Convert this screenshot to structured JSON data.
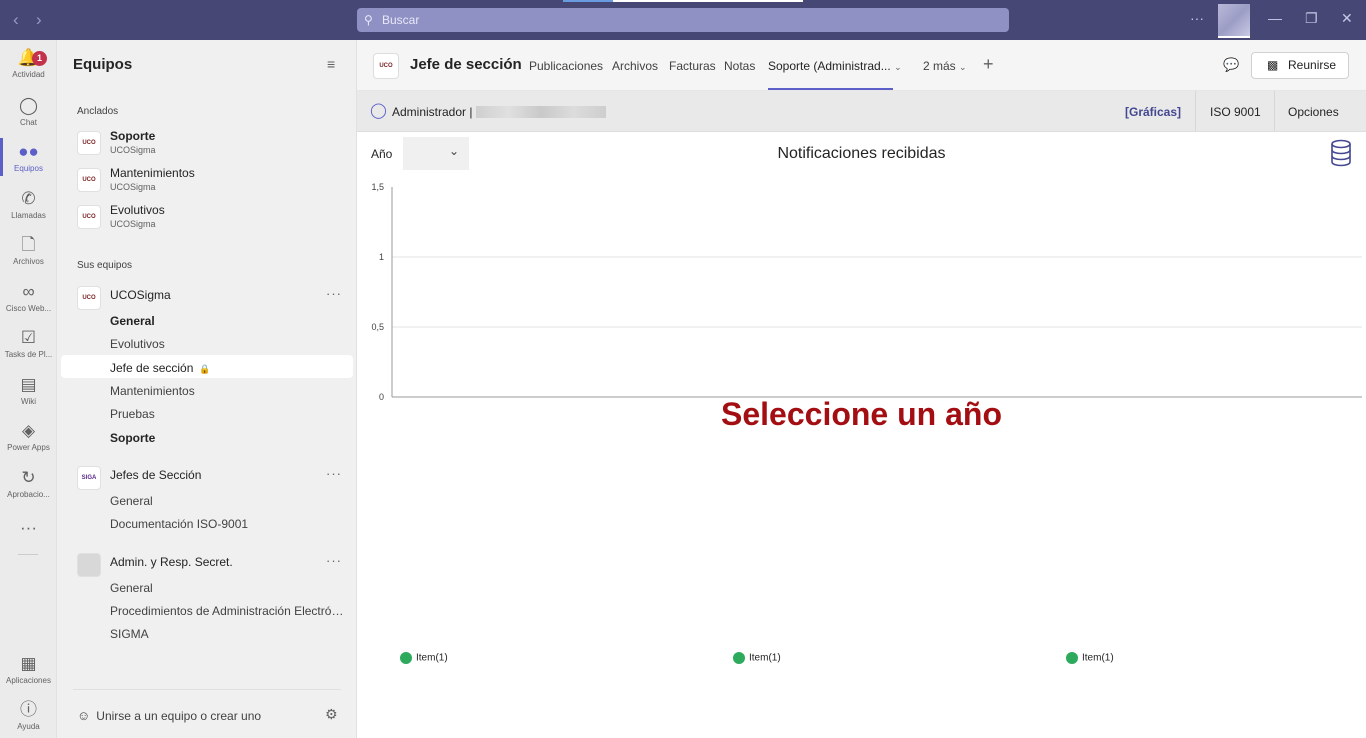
{
  "titlebar": {
    "search_placeholder": "Buscar",
    "more": "···"
  },
  "rail": {
    "items": [
      {
        "label": "Actividad",
        "icon": "bell-icon",
        "badge": "1"
      },
      {
        "label": "Chat",
        "icon": "chat-icon"
      },
      {
        "label": "Equipos",
        "icon": "teams-icon"
      },
      {
        "label": "Llamadas",
        "icon": "phone-icon"
      },
      {
        "label": "Archivos",
        "icon": "file-icon"
      },
      {
        "label": "Cisco Web...",
        "icon": "webex-icon"
      },
      {
        "label": "Tasks de Pl...",
        "icon": "tasks-icon"
      },
      {
        "label": "Wiki",
        "icon": "wiki-icon"
      },
      {
        "label": "Power Apps",
        "icon": "powerapps-icon"
      },
      {
        "label": "Aprobacio...",
        "icon": "approvals-icon"
      },
      {
        "label": "Aplicaciones",
        "icon": "apps-icon"
      },
      {
        "label": "Ayuda",
        "icon": "help-icon"
      }
    ],
    "more": "···"
  },
  "teamlist": {
    "title": "Equipos",
    "pinned_label": "Anclados",
    "pinned": [
      {
        "name": "Soporte",
        "sub": "UCOSigma"
      },
      {
        "name": "Mantenimientos",
        "sub": "UCOSigma"
      },
      {
        "name": "Evolutivos",
        "sub": "UCOSigma"
      }
    ],
    "your_teams_label": "Sus equipos",
    "teams": [
      {
        "name": "UCOSigma",
        "logo": "UCO",
        "channels": [
          "General",
          "Evolutivos",
          "Jefe de sección",
          "Mantenimientos",
          "Pruebas",
          "Soporte"
        ]
      },
      {
        "name": "Jefes de Sección",
        "logo": "SIGA",
        "channels": [
          "General",
          "Documentación ISO-9001"
        ]
      },
      {
        "name": "Admin. y Resp. Secret.",
        "logo": "",
        "channels": [
          "General",
          "Procedimientos de Administración Electróni...",
          "SIGMA"
        ]
      }
    ],
    "join_label": "Unirse a un equipo o crear uno"
  },
  "channel_header": {
    "logo": "UCO",
    "title": "Jefe de sección",
    "tabs": [
      "Publicaciones",
      "Archivos",
      "Facturas",
      "Notas",
      "Soporte (Administrad...",
      "2 más"
    ],
    "meet_label": "Reunirse"
  },
  "subheader": {
    "admin_label": "Administrador |",
    "links": [
      "[Gráficas]",
      "ISO 9001",
      "Opciones"
    ]
  },
  "chart_controls": {
    "year_label": "Año",
    "year_value": ""
  },
  "chart_data": {
    "type": "line",
    "title": "Notificaciones recibidas",
    "xlabel": "",
    "ylabel": "",
    "ylim": [
      0,
      1.5
    ],
    "yticks": [
      "1,5",
      "1",
      "0,5",
      "0"
    ],
    "series": [
      {
        "name": "Item(1)",
        "values": []
      },
      {
        "name": "Item(1)",
        "values": []
      },
      {
        "name": "Item(1)",
        "values": []
      }
    ],
    "legend_color": "#2eaa5d",
    "grid": true,
    "legend_position": "bottom"
  },
  "message": "Seleccione un año",
  "colors": {
    "titlebar": "#464775",
    "accent": "#5b5fc7",
    "message": "#a30e13",
    "legend": "#2eaa5d"
  }
}
